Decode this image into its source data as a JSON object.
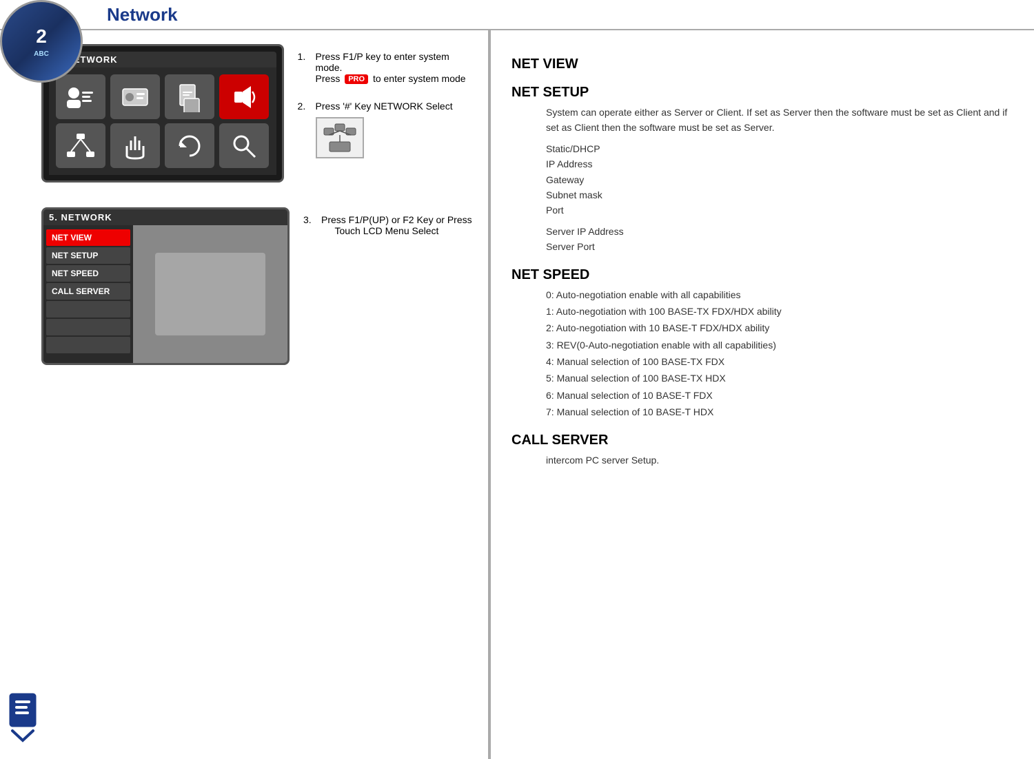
{
  "header": {
    "title": "Network"
  },
  "logo": {
    "number": "2",
    "lines": [
      "ABC",
      ""
    ]
  },
  "left": {
    "screen1": {
      "title": "5. NETWORK",
      "buttons": [
        {
          "icon": "person-list"
        },
        {
          "icon": "id-card"
        },
        {
          "icon": "document"
        },
        {
          "icon": "speaker"
        },
        {
          "icon": "network"
        },
        {
          "icon": "hand"
        },
        {
          "icon": "refresh"
        },
        {
          "icon": "search"
        }
      ]
    },
    "screen2": {
      "title": "5. NETWORK",
      "menu_items": [
        {
          "label": "NET VIEW",
          "style": "active"
        },
        {
          "label": "NET SETUP",
          "style": "dark"
        },
        {
          "label": "NET SPEED",
          "style": "dark"
        },
        {
          "label": "CALL SERVER",
          "style": "dark"
        },
        {
          "label": "",
          "style": "dark"
        },
        {
          "label": "",
          "style": "dark"
        },
        {
          "label": "",
          "style": "dark"
        }
      ]
    },
    "steps": [
      {
        "num": "1.",
        "text": "Press F1/P key to enter system mode.",
        "sub": "Press  to enter system mode"
      },
      {
        "num": "2.",
        "text": "Press '#' Key NETWORK Select"
      },
      {
        "num": "3.",
        "text": "Press  F1/P(UP) or F2 Key or  Press Touch LCD Menu Select"
      }
    ],
    "pro_label": "PRO"
  },
  "right": {
    "sections": [
      {
        "heading": "NET VIEW",
        "body": []
      },
      {
        "heading": "NET SETUP",
        "body": [
          "System can operate either as Server or Client. If set as Server then the software must be set as Client and if set as Client then the software must be set as Server.",
          "",
          "Static/DHCP",
          "IP Address",
          "Gateway",
          "Subnet mask",
          "Port",
          "",
          "Server IP Address",
          "Server Port"
        ]
      },
      {
        "heading": "NET SPEED",
        "body": [
          "0: Auto-negotiation enable with all capabilities",
          "1: Auto-negotiation with 100 BASE-TX FDX/HDX ability",
          "2: Auto-negotiation with 10 BASE-T FDX/HDX ability",
          "3: REV(0-Auto-negotiation enable with all capabilities)",
          "4: Manual selection of 100 BASE-TX FDX",
          "5: Manual selection of 100 BASE-TX HDX",
          "6: Manual selection of 10 BASE-T FDX",
          "7: Manual selection of 10 BASE-T HDX"
        ]
      },
      {
        "heading": "CALL SERVER",
        "body": [
          "intercom PC server Setup."
        ]
      }
    ]
  }
}
